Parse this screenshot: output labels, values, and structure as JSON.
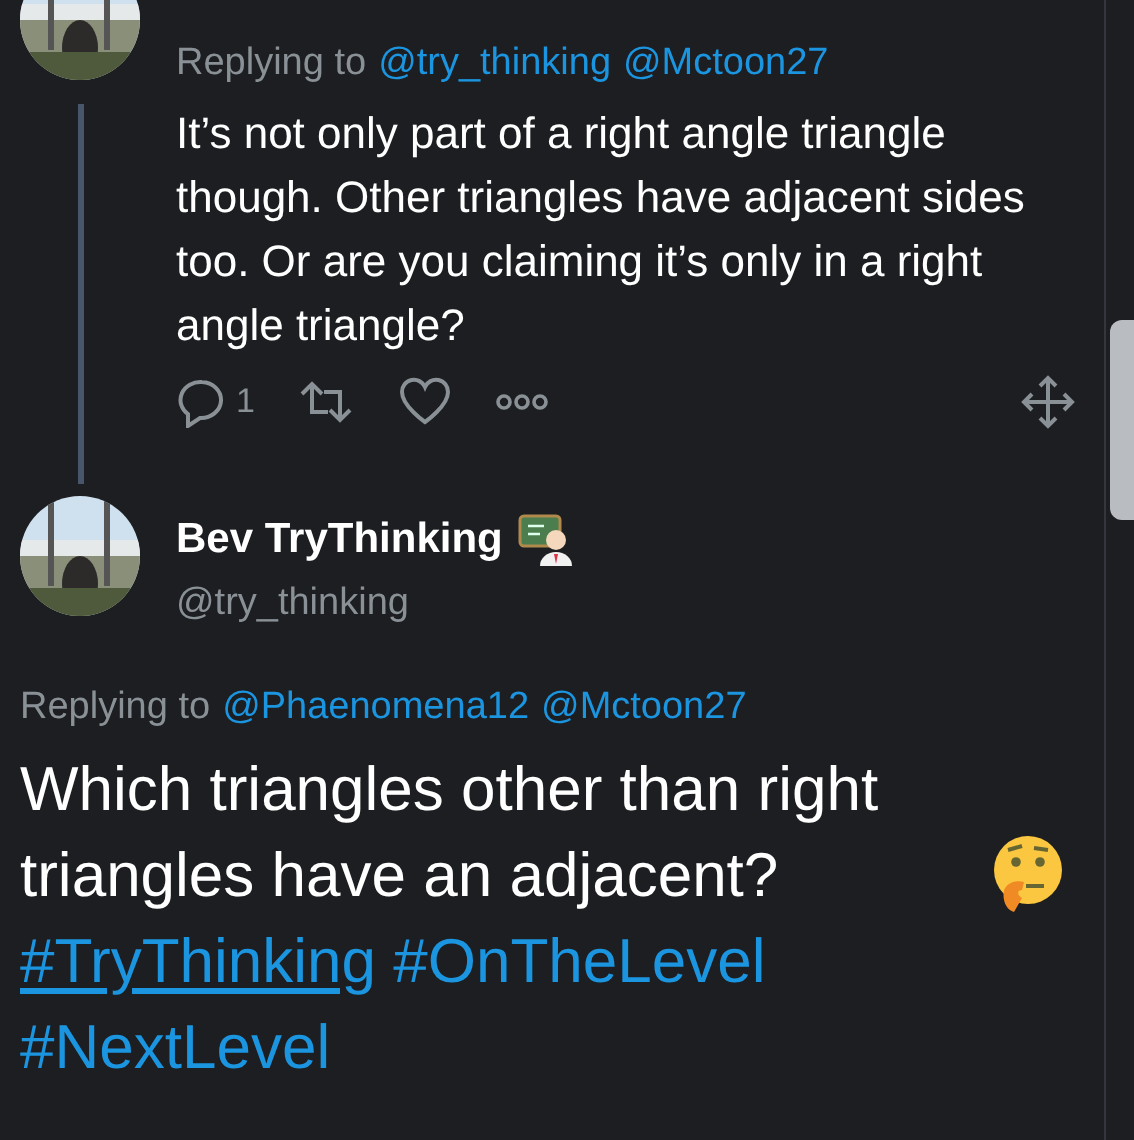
{
  "parent_tweet": {
    "avatar": {
      "kind": "picture"
    },
    "replying_label": "Replying to",
    "replying_to": [
      "@try_thinking",
      "@Mctoon27"
    ],
    "text": "It’s not only part of a right angle triangle though. Other triangles have adjacent sides too. Or are you claiming it’s only in a right angle triangle?",
    "reply_count": "1"
  },
  "tweet": {
    "avatar": {
      "kind": "picture"
    },
    "name": "Bev TryThinking",
    "handle": "@try_thinking",
    "replying_label": "Replying to",
    "replying_to": [
      "@Phaenomena12",
      "@Mctoon27"
    ],
    "text": "Which triangles other than right triangles have an adjacent?",
    "hashtags": [
      {
        "text": "#TryThinking",
        "hovered": true
      },
      {
        "text": "#OnTheLevel",
        "hovered": false
      },
      {
        "text": "#NextLevel",
        "hovered": false
      }
    ]
  }
}
